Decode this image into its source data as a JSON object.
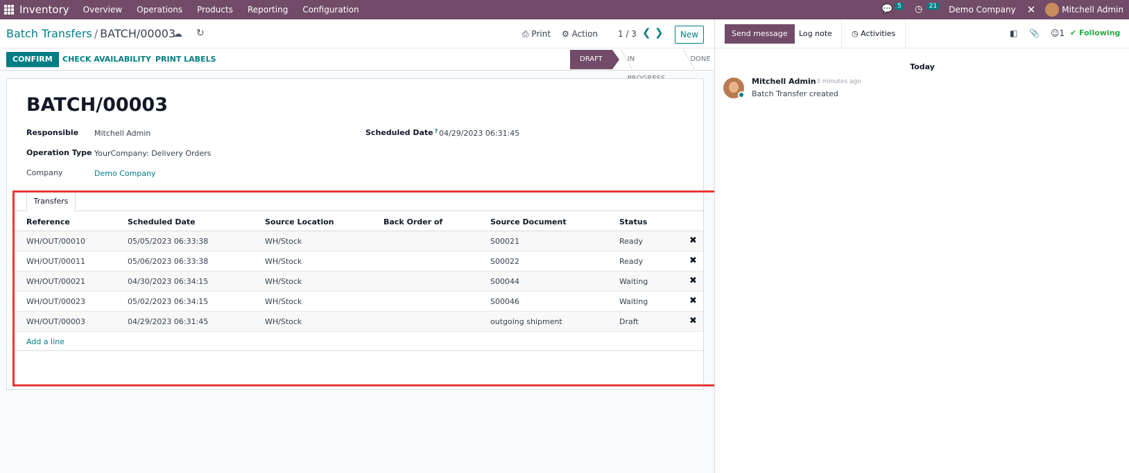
{
  "app": {
    "name": "Inventory",
    "menus": [
      "Overview",
      "Operations",
      "Products",
      "Reporting",
      "Configuration"
    ],
    "messages_count": "5",
    "activities_count": "21",
    "company": "Demo Company",
    "user": "Mitchell Admin"
  },
  "control": {
    "breadcrumb_parent": "Batch Transfers",
    "breadcrumb_sep": "/",
    "breadcrumb_current": "BATCH/00003",
    "print_label": "Print",
    "action_label": "Action",
    "pager": "1 / 3",
    "new_label": "New"
  },
  "statusbar": {
    "confirm_label": "CONFIRM",
    "check_label": "CHECK AVAILABILITY",
    "print_labels_label": "PRINT LABELS",
    "stages": [
      "DRAFT",
      "IN PROGRESS",
      "DONE"
    ],
    "active_stage": "DRAFT"
  },
  "form": {
    "title": "BATCH/00003",
    "responsible_label": "Responsible",
    "responsible_value": "Mitchell Admin",
    "operation_type_label": "Operation Type",
    "operation_type_value": "YourCompany: Delivery Orders",
    "company_label": "Company",
    "company_value": "Demo Company",
    "scheduled_date_label": "Scheduled Date",
    "scheduled_date_help": "?",
    "scheduled_date_value": "04/29/2023 06:31:45"
  },
  "transfers": {
    "tab_label": "Transfers",
    "columns": [
      "Reference",
      "Scheduled Date",
      "Source Location",
      "Back Order of",
      "Source Document",
      "Status"
    ],
    "rows": [
      {
        "reference": "WH/OUT/00010",
        "date": "05/05/2023 06:33:38",
        "source": "WH/Stock",
        "backorder": "",
        "document": "S00021",
        "status": "Ready"
      },
      {
        "reference": "WH/OUT/00011",
        "date": "05/06/2023 06:33:38",
        "source": "WH/Stock",
        "backorder": "",
        "document": "S00022",
        "status": "Ready"
      },
      {
        "reference": "WH/OUT/00021",
        "date": "04/30/2023 06:34:15",
        "source": "WH/Stock",
        "backorder": "",
        "document": "S00044",
        "status": "Waiting"
      },
      {
        "reference": "WH/OUT/00023",
        "date": "05/02/2023 06:34:15",
        "source": "WH/Stock",
        "backorder": "",
        "document": "S00046",
        "status": "Waiting"
      },
      {
        "reference": "WH/OUT/00003",
        "date": "04/29/2023 06:31:45",
        "source": "WH/Stock",
        "backorder": "",
        "document": "outgoing shipment",
        "status": "Draft"
      }
    ],
    "add_line_label": "Add a line"
  },
  "chatter": {
    "send_message_label": "Send message",
    "log_note_label": "Log note",
    "activities_label": "Activities",
    "followers_count": "1",
    "following_label": "Following",
    "date_separator": "Today",
    "messages": [
      {
        "author": "Mitchell Admin",
        "time": "- 3 minutes ago",
        "body": "Batch Transfer created"
      }
    ]
  },
  "colors": {
    "brand": "#714b67",
    "accent": "#017e84",
    "highlight": "#e53935",
    "following": "#28a745"
  }
}
